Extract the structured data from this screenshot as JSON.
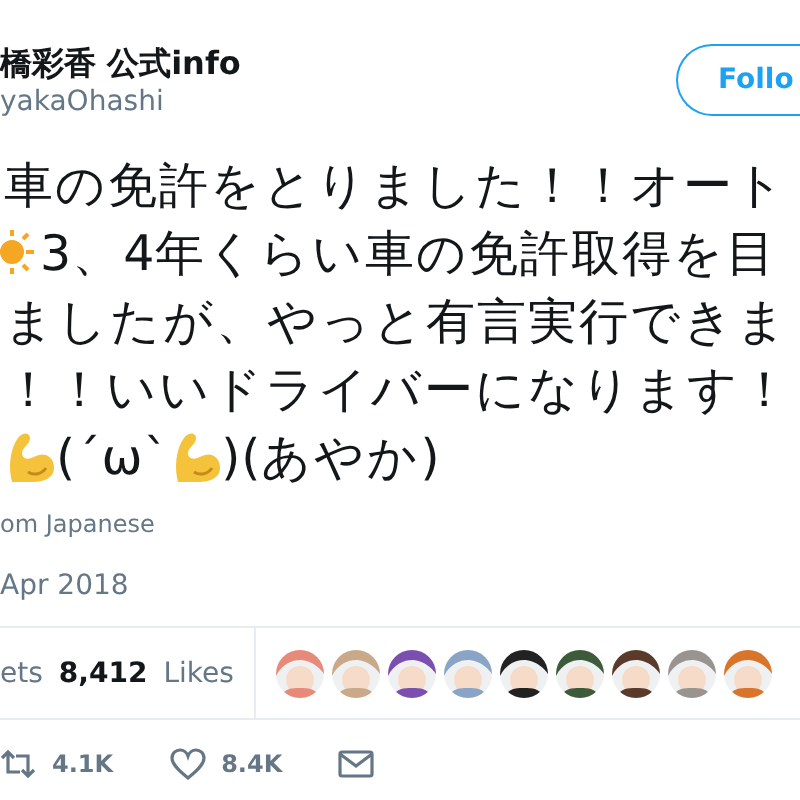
{
  "author": {
    "name": "橋彩香 公式info",
    "handle": "yakaOhashi"
  },
  "follow_button": {
    "label": "Follo"
  },
  "tweet_lines": [
    {
      "kind": "text",
      "text": "車の免許をとりました！！オート"
    },
    {
      "kind": "sun",
      "text": "3、4年くらい車の免許取得を目"
    },
    {
      "kind": "text",
      "text": "ましたが、やっと有言実行できま"
    },
    {
      "kind": "text",
      "text": "！！いいドライバーになります！"
    },
    {
      "kind": "muscle",
      "parts": [
        "(´ω`",
        ")(あやか)"
      ]
    }
  ],
  "translate_link": "om Japanese",
  "date": "Apr 2018",
  "stats": {
    "retweets_label": "ets",
    "likes_count": "8,412",
    "likes_label": "Likes"
  },
  "actions": {
    "retweets": "4.1K",
    "likes": "8.4K"
  }
}
